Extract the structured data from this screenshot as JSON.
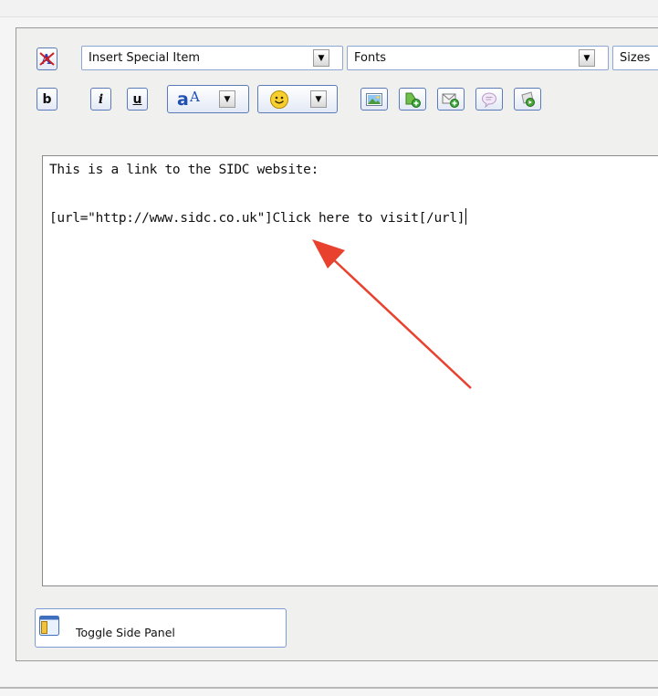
{
  "toolbar": {
    "insert_special_label": "Insert Special Item",
    "fonts_label": "Fonts",
    "sizes_label": "Sizes",
    "bold_label": "b",
    "italic_label": "i",
    "underline_label": "u"
  },
  "editor": {
    "line1": "This is a link to the SIDC website:",
    "line2": "[url=\"http://www.sidc.co.uk\"]Click here to visit[/url]"
  },
  "side_panel": {
    "toggle_label": "Toggle Side Panel"
  },
  "colors": {
    "annotation_arrow": "#e8422f",
    "button_border": "#5a7bb8"
  }
}
